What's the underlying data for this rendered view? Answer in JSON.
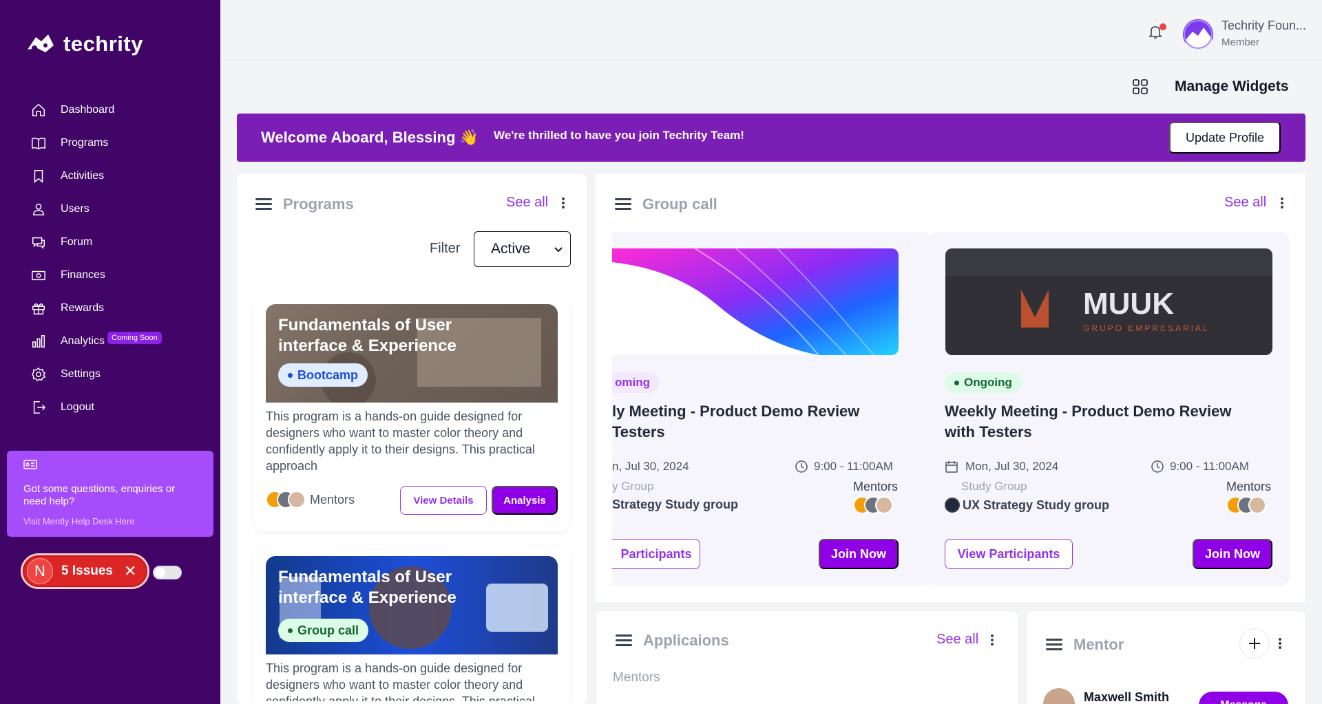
{
  "sidebar": {
    "brand": "techrity",
    "nav": [
      {
        "label": "Dashboard",
        "icon": "home-icon"
      },
      {
        "label": "Programs",
        "icon": "book-icon"
      },
      {
        "label": "Activities",
        "icon": "bookmark-icon"
      },
      {
        "label": "Users",
        "icon": "user-icon"
      },
      {
        "label": "Forum",
        "icon": "chat-icon"
      },
      {
        "label": "Finances",
        "icon": "money-icon"
      },
      {
        "label": "Rewards",
        "icon": "gift-icon"
      },
      {
        "label": "Analytics",
        "icon": "bar-chart-icon",
        "badge": "Coming Soon"
      },
      {
        "label": "Settings",
        "icon": "gear-icon"
      },
      {
        "label": "Logout",
        "icon": "logout-icon"
      }
    ],
    "help": {
      "text": "Got some questions, enquiries or need help?",
      "link": "Visit Mently Help Desk Here"
    },
    "issues": {
      "avatar": "N",
      "label": "5 Issues"
    }
  },
  "topbar": {
    "user_name": "Techrity Foun...",
    "user_role": "Member",
    "manage_widgets": "Manage Widgets"
  },
  "welcome": {
    "title": "Welcome Aboard, Blessing",
    "wave": "👋",
    "subtitle": "We're thrilled to have you join Techrity Team!",
    "button": "Update Profile"
  },
  "programs": {
    "title": "Programs",
    "see_all": "See all",
    "filter_label": "Filter",
    "filter_value": "Active",
    "items": [
      {
        "title": "Fundamentals of User interface & Experience",
        "tag": "Bootcamp",
        "description": "This program is a hands-on guide designed for designers who want to master color theory and confidently apply it to their designs. This practical approach",
        "mentors": "Mentors",
        "view_details": "View Details",
        "analysis": "Analysis"
      },
      {
        "title": "Fundamentals of User interface & Experience",
        "tag": "Group call",
        "description": "This program is a hands-on guide designed for designers who want to master color theory and confidently apply it to their designs. This practical"
      }
    ]
  },
  "group_call": {
    "title": "Group call",
    "see_all": "See all",
    "items": [
      {
        "status": "oming",
        "title": "ly Meeting - Product Demo Review Testers",
        "title_line1": "ly Meeting - Product Demo Review",
        "title_line2": "Testers",
        "date": "n, Jul 30, 2024",
        "time": "9:00 - 11:00AM",
        "group_label": "y Group",
        "mentors_label": "Mentors",
        "group_name": "Strategy Study group",
        "participants_btn": "Participants",
        "join_btn": "Join Now"
      },
      {
        "status": "Ongoing",
        "title_line1": "Weekly Meeting - Product Demo Review",
        "title_line2": "with Testers",
        "date": "Mon, Jul 30, 2024",
        "time": "9:00 - 11:00AM",
        "group_label": "Study Group",
        "mentors_label": "Mentors",
        "group_name": "UX Strategy Study group",
        "participants_btn": "View Participants",
        "join_btn": "Join Now",
        "image_text": "MUUK",
        "image_subtext": "GRUPO EMPRESARIAL"
      }
    ]
  },
  "applications": {
    "title": "Applicaions",
    "see_all": "See all",
    "section": "Mentors"
  },
  "mentor": {
    "title": "Mentor",
    "first_name": "Maxwell Smith",
    "message_btn": "Message"
  },
  "colors": {
    "sidebar": "#410467",
    "accent": "#9000e6",
    "welcome": "#7a1eb5"
  }
}
